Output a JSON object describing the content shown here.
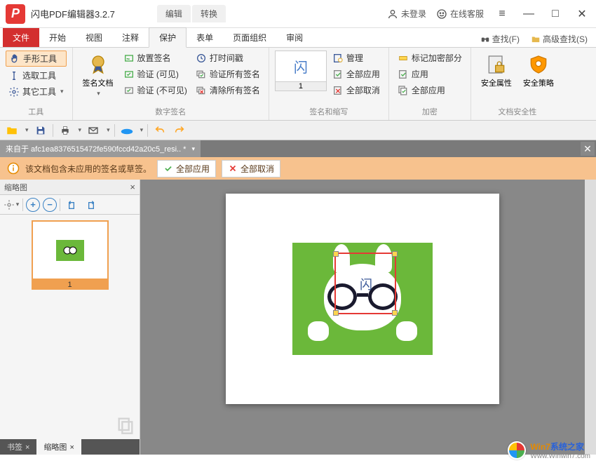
{
  "app": {
    "title": "闪电PDF编辑器3.2.7",
    "title_tabs": [
      "编辑",
      "转换"
    ]
  },
  "title_right": {
    "login": "未登录",
    "service": "在线客服"
  },
  "menu": {
    "file": "文件",
    "tabs": [
      "开始",
      "视图",
      "注释",
      "保护",
      "表单",
      "页面组织",
      "审阅"
    ],
    "active": "保护",
    "search": "查找(F)",
    "adv_search": "高级查找(S)"
  },
  "ribbon": {
    "tools": {
      "hand": "手形工具",
      "select": "选取工具",
      "other": "其它工具",
      "label": "工具"
    },
    "digisig": {
      "sigdoc": "签名文档",
      "place": "放置签名",
      "verify_vis": "验证 (可见)",
      "verify_invis": "验证 (不可见)",
      "time": "打时间戳",
      "verify_all": "验证所有签名",
      "clear_all": "清除所有签名",
      "label": "数字签名"
    },
    "sigwrite": {
      "preview_num": "1",
      "manage": "管理",
      "apply_all": "全部应用",
      "cancel_all": "全部取消",
      "label": "签名和缩写"
    },
    "encrypt": {
      "mark": "标记加密部分",
      "apply": "应用",
      "apply_all": "全部应用",
      "label": "加密"
    },
    "docsec": {
      "attr": "安全属性",
      "policy": "安全策略",
      "label": "文档安全性"
    }
  },
  "doc": {
    "tab": "来自于 afc1ea8376515472fe590fccd42a20c5_resi.. *"
  },
  "warn": {
    "msg": "该文档包含未应用的签名或草签。",
    "apply_all": "全部应用",
    "cancel_all": "全部取消"
  },
  "side": {
    "title": "缩略图",
    "thumb_label": "1",
    "tabs": {
      "bookmark": "书签",
      "thumb": "缩略图"
    }
  },
  "sig_glyph": "闪",
  "watermark": {
    "brand_a": "Win7",
    "brand_b": "系统之家",
    "url": "Www.Winwin7.com"
  }
}
